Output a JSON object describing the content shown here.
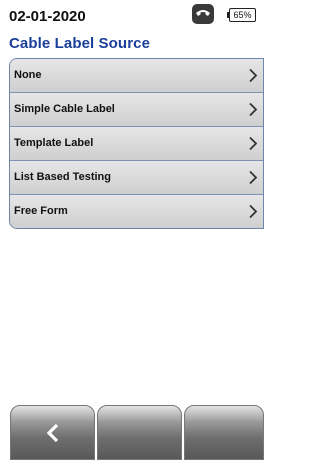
{
  "status": {
    "date": "02-01-2020",
    "icon": "phone-icon",
    "battery": "65%"
  },
  "title": "Cable Label Source",
  "menu": {
    "items": [
      {
        "label": "None"
      },
      {
        "label": "Simple Cable Label"
      },
      {
        "label": "Template Label"
      },
      {
        "label": "List Based Testing"
      },
      {
        "label": "Free Form"
      }
    ]
  },
  "softkeys": {
    "left": {
      "icon": "back-chevron-icon",
      "label": ""
    },
    "middle": {
      "label": ""
    },
    "right": {
      "label": ""
    }
  },
  "colors": {
    "title": "#1a3f9a",
    "menu_border": "#6f86a8",
    "menu_background": "#d8d8d8",
    "softkey_gradient_top": "#e4e4e4",
    "softkey_gradient_bottom": "#585858"
  }
}
